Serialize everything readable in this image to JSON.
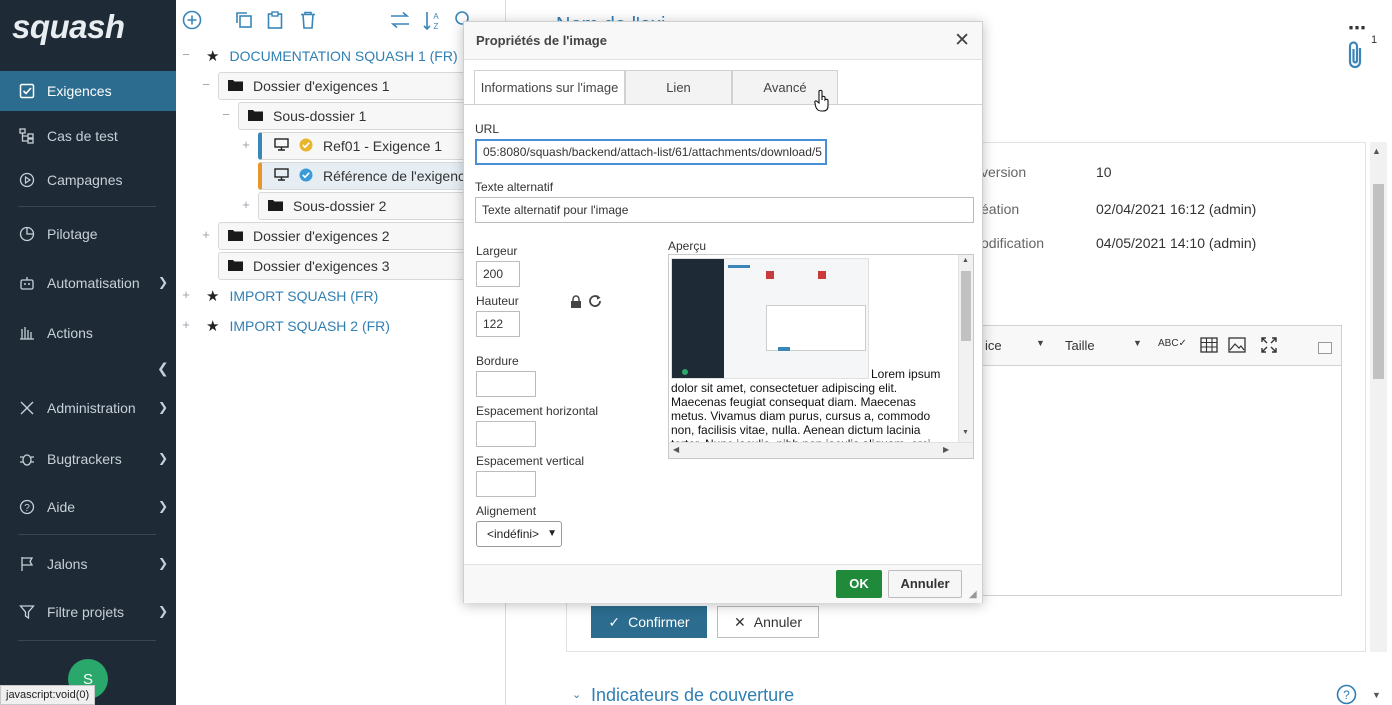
{
  "nav": {
    "logo": "squash",
    "items": [
      {
        "label": "Exigences",
        "icon": "requirements-icon",
        "active": true
      },
      {
        "label": "Cas de test",
        "icon": "test-case-icon"
      },
      {
        "label": "Campagnes",
        "icon": "campaign-icon"
      },
      {
        "label": "Pilotage",
        "icon": "pilot-icon"
      },
      {
        "label": "Automatisation",
        "icon": "robot-icon"
      },
      {
        "label": "Actions",
        "icon": "actions-icon"
      },
      {
        "label": "Administration",
        "icon": "admin-icon"
      },
      {
        "label": "Bugtrackers",
        "icon": "bug-icon"
      },
      {
        "label": "Aide",
        "icon": "help-icon"
      },
      {
        "label": "Jalons",
        "icon": "flag-icon"
      },
      {
        "label": "Filtre projets",
        "icon": "filter-icon"
      }
    ],
    "avatar": "S",
    "status_url": "javascript:void(0)"
  },
  "tree": {
    "nodes": [
      {
        "label": "DOCUMENTATION SQUASH 1 (FR)"
      },
      {
        "label": "Dossier d'exigences 1"
      },
      {
        "label": "Sous-dossier 1"
      },
      {
        "label": "Ref01 - Exigence 1"
      },
      {
        "label": "Référence de l'exigence"
      },
      {
        "label": "Sous-dossier 2"
      },
      {
        "label": "Dossier d'exigences 2"
      },
      {
        "label": "Dossier d'exigences 3"
      },
      {
        "label": "IMPORT SQUASH (FR)"
      },
      {
        "label": "IMPORT SQUASH 2 (FR)"
      }
    ]
  },
  "content": {
    "title_partial": "Nom de l'exi",
    "attachment_count": "1",
    "version_label": "version",
    "version_value": "10",
    "creation_label": "éation",
    "creation_value": "02/04/2021 16:12 (admin)",
    "modification_label": "odification",
    "modification_value": "04/05/2021 14:10 (admin)",
    "editor_font_partial": "ice",
    "editor_size": "Taille",
    "confirm_label": "Confirmer",
    "cancel_label": "Annuler",
    "coverage_title": "Indicateurs de couverture"
  },
  "dialog": {
    "title": "Propriétés de l'image",
    "tabs": [
      "Informations sur l'image",
      "Lien",
      "Avancé"
    ],
    "url_label": "URL",
    "url_value": "05:8080/squash/backend/attach-list/61/attachments/download/5",
    "alt_label": "Texte alternatif",
    "alt_value": "Texte alternatif pour l'image",
    "width_label": "Largeur",
    "width_value": "200",
    "height_label": "Hauteur",
    "height_value": "122",
    "border_label": "Bordure",
    "hspace_label": "Espacement horizontal",
    "vspace_label": "Espacement vertical",
    "align_label": "Alignement",
    "align_value": "<indéfini>",
    "preview_label": "Aperçu",
    "preview_text": "Lorem ipsum dolor sit amet, consectetuer adipiscing elit. Maecenas feugiat consequat diam. Maecenas metus. Vivamus diam purus, cursus a, commodo non, facilisis vitae, nulla. Aenean dictum lacinia tortor. Nunc iaculis, nibh non iaculis aliquam, orci felis",
    "ok_label": "OK",
    "cancel_label": "Annuler"
  }
}
